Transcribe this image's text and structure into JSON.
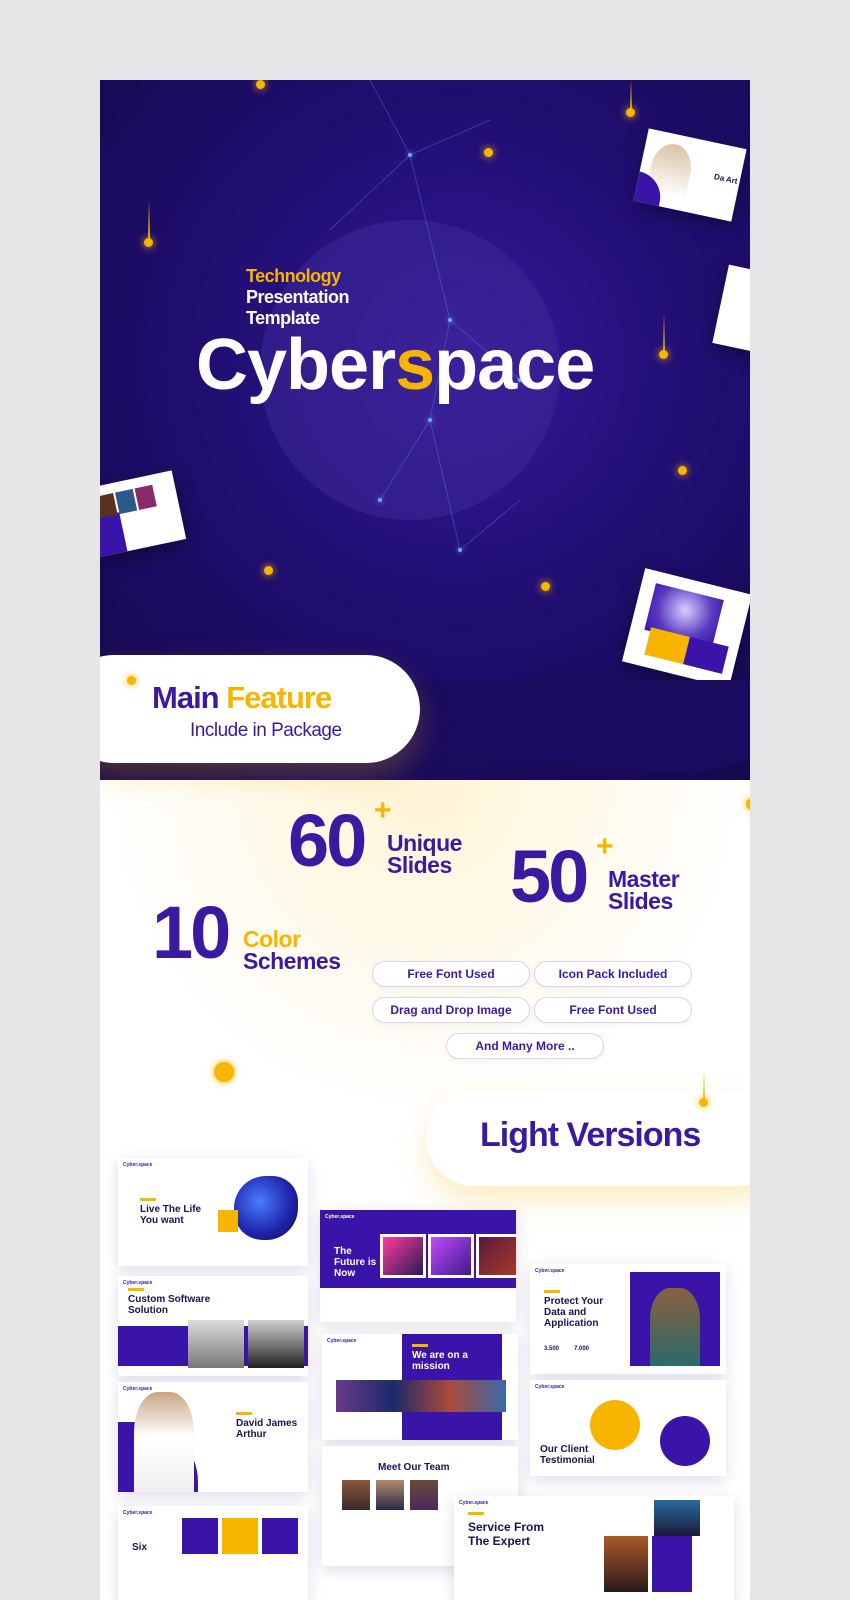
{
  "hero": {
    "pretitle_1": "Technology",
    "pretitle_2": "Presentation",
    "pretitle_3": "Template",
    "title_part1": "Cyber",
    "title_highlight": "s",
    "title_part2": "pace"
  },
  "feature": {
    "title_word1": "Main",
    "title_word2": "Feature",
    "subtitle": "Include in Package"
  },
  "stats": [
    {
      "number": "60",
      "plus": "+",
      "label_1": "Unique",
      "label_2": "Slides"
    },
    {
      "number": "50",
      "plus": "+",
      "label_1": "Master",
      "label_2": "Slides"
    },
    {
      "number": "10",
      "label_1": "Color",
      "label_2": "Schemes"
    }
  ],
  "chips": [
    "Free Font Used",
    "Icon Pack Included",
    "Drag and Drop Image",
    "Free Font Used",
    "And Many More .."
  ],
  "light_versions": "Light Versions",
  "slides": {
    "logo": "Cyber.space",
    "s1_title": "Live The Life You want",
    "s2_title": "The Future is Now",
    "s3_title": "Custom Software Solution",
    "s4_title": "Protect Your Data and Application",
    "s4_stat1": "3.500",
    "s4_stat2": "7.000",
    "s5_title": "We are on a mission",
    "s6_title": "David James Arthur",
    "s7_title": "Our Client Testimonial",
    "s8_title": "Meet Our Team",
    "s9_title": "Service From The Expert",
    "s10_title": "Six",
    "hero_thumb_title": "Da Art"
  },
  "colors": {
    "brand_purple": "#3a1aa0",
    "hero_dark": "#1a0b5e",
    "accent_yellow": "#f7b500"
  }
}
